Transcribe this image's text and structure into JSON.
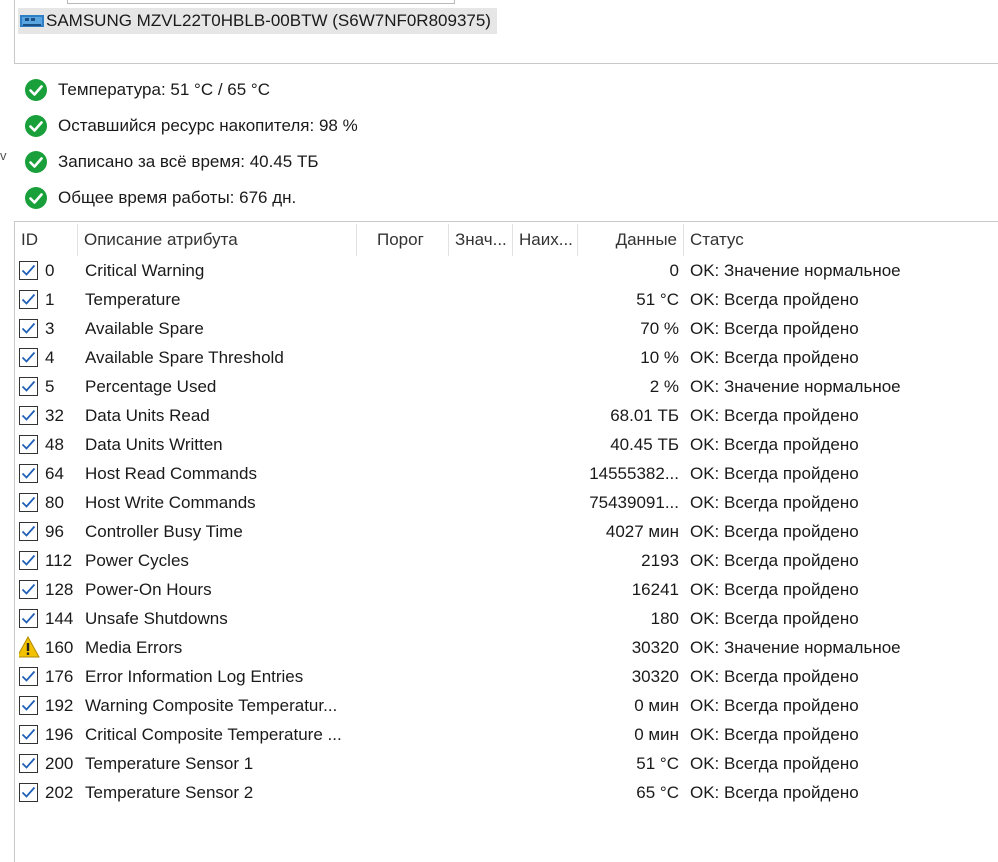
{
  "drive": {
    "label": "SAMSUNG MZVL22T0HBLB-00BTW (S6W7NF0R809375)",
    "icon": "drive-icon"
  },
  "side_mark": "v",
  "summary": [
    {
      "icon": "check-circle-icon",
      "text": "Температура: 51 °C / 65 °C"
    },
    {
      "icon": "check-circle-icon",
      "text": "Оставшийся ресурс накопителя: 98 %"
    },
    {
      "icon": "check-circle-icon",
      "text": "Записано за всё время: 40.45 ТБ"
    },
    {
      "icon": "check-circle-icon",
      "text": "Общее время работы: 676 дн."
    }
  ],
  "table": {
    "headers": {
      "id": "ID",
      "desc": "Описание атрибута",
      "threshold": "Порог",
      "value": "Знач...",
      "worst": "Наих...",
      "data": "Данные",
      "status": "Статус"
    },
    "rows": [
      {
        "icon": "checkbox-checked-icon",
        "id": "0",
        "desc": "Critical Warning",
        "data": "0",
        "status": "OK: Значение нормальное"
      },
      {
        "icon": "checkbox-checked-icon",
        "id": "1",
        "desc": "Temperature",
        "data": "51 °C",
        "status": "OK: Всегда пройдено"
      },
      {
        "icon": "checkbox-checked-icon",
        "id": "3",
        "desc": "Available Spare",
        "data": "70 %",
        "status": "OK: Всегда пройдено"
      },
      {
        "icon": "checkbox-checked-icon",
        "id": "4",
        "desc": "Available Spare Threshold",
        "data": "10 %",
        "status": "OK: Всегда пройдено"
      },
      {
        "icon": "checkbox-checked-icon",
        "id": "5",
        "desc": "Percentage Used",
        "data": "2 %",
        "status": "OK: Значение нормальное"
      },
      {
        "icon": "checkbox-checked-icon",
        "id": "32",
        "desc": "Data Units Read",
        "data": "68.01 ТБ",
        "status": "OK: Всегда пройдено"
      },
      {
        "icon": "checkbox-checked-icon",
        "id": "48",
        "desc": "Data Units Written",
        "data": "40.45 ТБ",
        "status": "OK: Всегда пройдено"
      },
      {
        "icon": "checkbox-checked-icon",
        "id": "64",
        "desc": "Host Read Commands",
        "data": "14555382...",
        "status": "OK: Всегда пройдено"
      },
      {
        "icon": "checkbox-checked-icon",
        "id": "80",
        "desc": "Host Write Commands",
        "data": "75439091...",
        "status": "OK: Всегда пройдено"
      },
      {
        "icon": "checkbox-checked-icon",
        "id": "96",
        "desc": "Controller Busy Time",
        "data": "4027 мин",
        "status": "OK: Всегда пройдено"
      },
      {
        "icon": "checkbox-checked-icon",
        "id": "112",
        "desc": "Power Cycles",
        "data": "2193",
        "status": "OK: Всегда пройдено"
      },
      {
        "icon": "checkbox-checked-icon",
        "id": "128",
        "desc": "Power-On Hours",
        "data": "16241",
        "status": "OK: Всегда пройдено"
      },
      {
        "icon": "checkbox-checked-icon",
        "id": "144",
        "desc": "Unsafe Shutdowns",
        "data": "180",
        "status": "OK: Всегда пройдено"
      },
      {
        "icon": "warning-icon",
        "id": "160",
        "desc": "Media Errors",
        "data": "30320",
        "status": "OK: Значение нормальное"
      },
      {
        "icon": "checkbox-checked-icon",
        "id": "176",
        "desc": "Error Information Log Entries",
        "data": "30320",
        "status": "OK: Всегда пройдено"
      },
      {
        "icon": "checkbox-checked-icon",
        "id": "192",
        "desc": "Warning Composite Temperatur...",
        "data": "0 мин",
        "status": "OK: Всегда пройдено"
      },
      {
        "icon": "checkbox-checked-icon",
        "id": "196",
        "desc": "Critical Composite Temperature ...",
        "data": "0 мин",
        "status": "OK: Всегда пройдено"
      },
      {
        "icon": "checkbox-checked-icon",
        "id": "200",
        "desc": "Temperature Sensor 1",
        "data": "51 °C",
        "status": "OK: Всегда пройдено"
      },
      {
        "icon": "checkbox-checked-icon",
        "id": "202",
        "desc": "Temperature Sensor 2",
        "data": "65 °C",
        "status": "OK: Всегда пройдено"
      }
    ]
  },
  "colors": {
    "ok_green": "#1aa03a",
    "checkbox_blue": "#1f5fb8",
    "warning_yellow": "#f2c200"
  }
}
